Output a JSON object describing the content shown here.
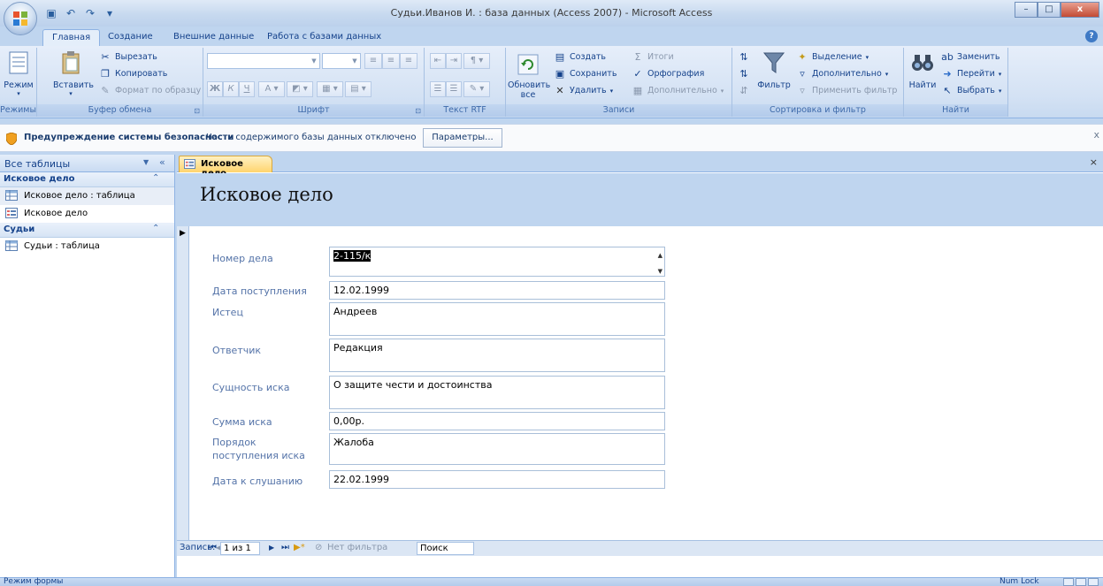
{
  "window": {
    "title": "Судьи.Иванов И. : база данных (Access 2007) - Microsoft Access",
    "minimize": "–",
    "maximize": "□",
    "close": "x"
  },
  "ribbon": {
    "tabs": [
      "Главная",
      "Создание",
      "Внешние данные",
      "Работа с базами данных"
    ],
    "views": {
      "button": "Режим",
      "group": "Режимы"
    },
    "clipboard": {
      "paste": "Вставить",
      "cut": "Вырезать",
      "copy": "Копировать",
      "format_painter": "Формат по образцу",
      "group": "Буфер обмена"
    },
    "font": {
      "bold": "Ж",
      "italic": "К",
      "underline": "Ч",
      "font_color": "A",
      "group": "Шрифт"
    },
    "rich_text": {
      "group": "Текст RTF"
    },
    "records": {
      "refresh_line1": "Обновить",
      "refresh_line2": "все",
      "new": "Создать",
      "save": "Сохранить",
      "delete": "Удалить",
      "totals": "Итоги",
      "spelling": "Орфография",
      "more": "Дополнительно",
      "group": "Записи"
    },
    "sort_filter": {
      "filter": "Фильтр",
      "selection": "Выделение",
      "advanced": "Дополнительно",
      "apply_filter": "Применить фильтр",
      "group": "Сортировка и фильтр"
    },
    "find": {
      "find": "Найти",
      "replace": "Заменить",
      "goto": "Перейти",
      "select": "Выбрать",
      "group": "Найти"
    }
  },
  "security_bar": {
    "title": "Предупреждение системы безопасности",
    "message": "Часть содержимого базы данных отключено",
    "button": "Параметры..."
  },
  "nav_pane": {
    "header": "Все таблицы",
    "groups": [
      {
        "name": "Исковое дело",
        "items": [
          {
            "label": "Исковое дело : таблица"
          },
          {
            "label": "Исковое дело"
          }
        ]
      },
      {
        "name": "Судьи",
        "items": [
          {
            "label": "Судьи : таблица"
          }
        ]
      }
    ]
  },
  "document": {
    "tab_label": "Исковое дело",
    "form_title": "Исковое дело",
    "fields": [
      {
        "label": "Номер дела",
        "value": "2-115/к"
      },
      {
        "label": "Дата поступления",
        "value": "12.02.1999"
      },
      {
        "label": "Истец",
        "value": "Андреев"
      },
      {
        "label": "Ответчик",
        "value": "Редакция"
      },
      {
        "label": "Сущность иска",
        "value": "О защите чести и достоинства"
      },
      {
        "label": "Сумма иска",
        "value": "0,00р."
      },
      {
        "label": "Порядок поступления иска",
        "value": "Жалоба"
      },
      {
        "label": "Дата к слушанию",
        "value": "22.02.1999"
      }
    ]
  },
  "record_nav": {
    "label": "Запись:",
    "position": "1 из 1",
    "filter": "Нет фильтра",
    "search": "Поиск"
  },
  "status": {
    "mode": "Режим формы",
    "numlock": "Num Lock"
  }
}
